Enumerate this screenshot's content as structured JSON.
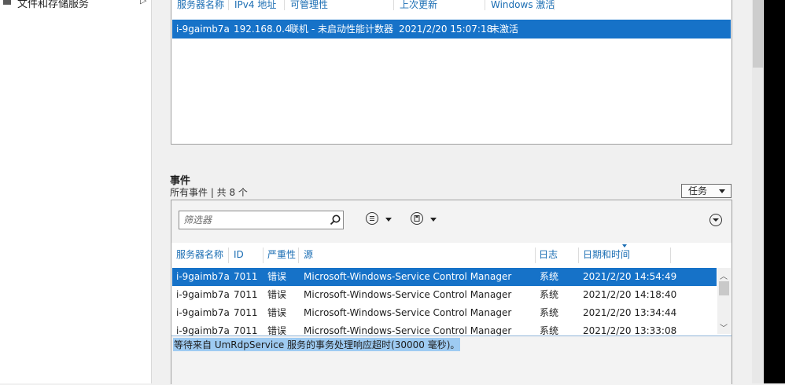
{
  "nav": {
    "item_label": "文件和存储服务"
  },
  "servers": {
    "columns": [
      "服务器名称",
      "IPv4 地址",
      "可管理性",
      "上次更新",
      "Windows 激活"
    ],
    "rows": [
      [
        "i-9gaimb7a",
        "192.168.0.4",
        "联机 - 未启动性能计数器",
        "2021/2/20 15:07:18",
        "未激活"
      ]
    ]
  },
  "events": {
    "title": "事件",
    "subtitle": "所有事件 | 共 8 个",
    "tasks_label": "任务",
    "filter_placeholder": "筛选器",
    "columns": [
      "服务器名称",
      "ID",
      "严重性",
      "源",
      "日志",
      "日期和时间"
    ],
    "rows": [
      [
        "i-9gaimb7a",
        "7011",
        "错误",
        "Microsoft-Windows-Service Control Manager",
        "系统",
        "2021/2/20 14:54:49"
      ],
      [
        "i-9gaimb7a",
        "7011",
        "错误",
        "Microsoft-Windows-Service Control Manager",
        "系统",
        "2021/2/20 14:18:40"
      ],
      [
        "i-9gaimb7a",
        "7011",
        "错误",
        "Microsoft-Windows-Service Control Manager",
        "系统",
        "2021/2/20 13:34:44"
      ],
      [
        "i-9gaimb7a",
        "7011",
        "错误",
        "Microsoft-Windows-Service Control Manager",
        "系统",
        "2021/2/20 13:33:08"
      ]
    ],
    "detail": "等待来自 UmRdpService 服务的事务处理响应超时(30000 毫秒)。"
  },
  "colors": {
    "accent": "#1672c8",
    "header_text": "#1a6db3",
    "selection_text": "#9ecbf2"
  }
}
